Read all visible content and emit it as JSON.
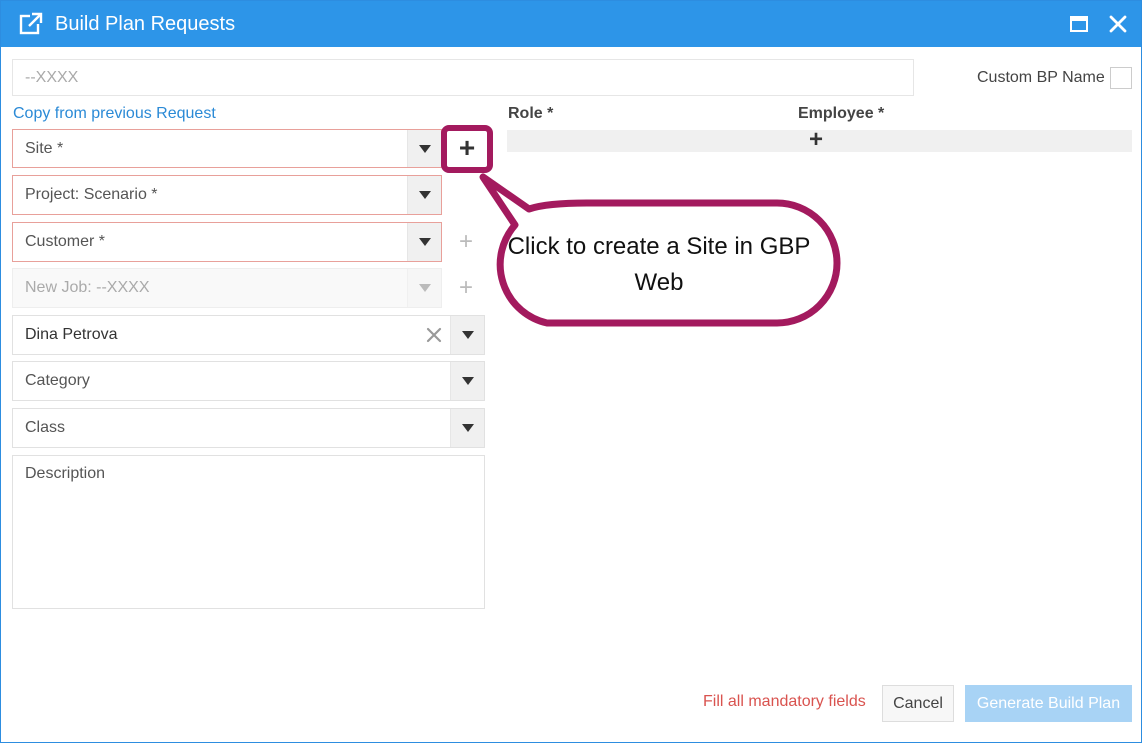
{
  "window": {
    "title": "Build Plan Requests",
    "accent_color": "#2d95e8",
    "icons": {
      "title": "external-link-icon",
      "maximize": "maximize-icon",
      "close": "close-icon"
    }
  },
  "name_field": {
    "value": "",
    "placeholder": "--XXXX"
  },
  "custom_name": {
    "label": "Custom BP Name",
    "checked": false
  },
  "copy_link": "Copy from previous Request",
  "form": {
    "site": {
      "placeholder": "Site *"
    },
    "project": {
      "placeholder": "Project: Scenario *"
    },
    "customer": {
      "placeholder": "Customer *"
    },
    "new_job": {
      "placeholder": "New Job: --XXXX"
    },
    "employee": {
      "value": "Dina Petrova"
    },
    "category": {
      "placeholder": "Category"
    },
    "class": {
      "placeholder": "Class"
    },
    "description": {
      "placeholder": "Description"
    }
  },
  "roles_table": {
    "headers": {
      "role": "Role *",
      "employee": "Employee *"
    },
    "add_symbol": "+"
  },
  "plus_symbol": "+",
  "callout": {
    "text": "Click to create a Site in GBP Web",
    "color": "#a31a5e"
  },
  "footer": {
    "warning": "Fill all mandatory fields",
    "warning_color": "#d9534f",
    "cancel": "Cancel",
    "generate": "Generate Build Plan"
  }
}
